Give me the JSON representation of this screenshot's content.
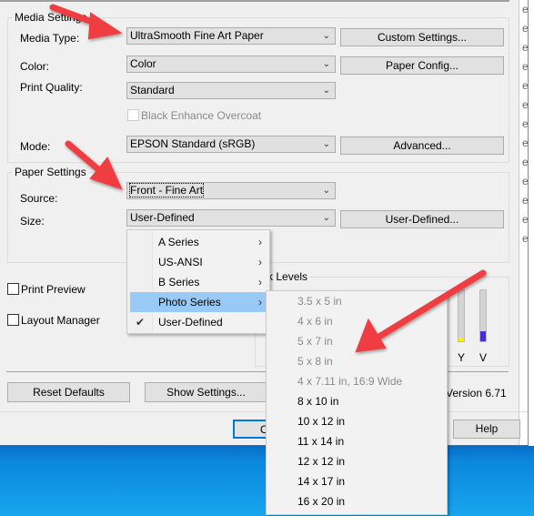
{
  "media_settings": {
    "title": "Media Settings",
    "media_type": {
      "label": "Media Type:",
      "value": "UltraSmooth Fine Art Paper",
      "button": "Custom Settings..."
    },
    "color": {
      "label": "Color:",
      "value": "Color",
      "button": "Paper Config..."
    },
    "print_quality": {
      "label": "Print Quality:",
      "value": "Standard"
    },
    "black_enhance": {
      "label": "Black Enhance Overcoat",
      "checked": false,
      "disabled": true
    },
    "mode": {
      "label": "Mode:",
      "value": "EPSON Standard (sRGB)",
      "button": "Advanced..."
    }
  },
  "paper_settings": {
    "title": "Paper Settings",
    "source": {
      "label": "Source:",
      "value": "Front - Fine Art"
    },
    "size": {
      "label": "Size:",
      "value": "User-Defined",
      "button": "User-Defined..."
    }
  },
  "print_preview": {
    "label": "Print Preview",
    "checked": false
  },
  "layout_manager": {
    "label": "Layout Manager",
    "checked": false
  },
  "ink_levels": {
    "title": "Ink Levels",
    "inks": [
      {
        "label": "Y",
        "color": "#ffee00",
        "level": 0.08
      },
      {
        "label": "V",
        "color": "#4b2bd8",
        "level": 0.2
      }
    ]
  },
  "buttons": {
    "reset": "Reset Defaults",
    "show_settings": "Show Settings...",
    "ok": "OK",
    "help": "Help"
  },
  "version": "Version 6.71",
  "size_menu": {
    "items": [
      {
        "label": "A Series",
        "submenu": true
      },
      {
        "label": "US-ANSI",
        "submenu": true
      },
      {
        "label": "B Series",
        "submenu": true
      },
      {
        "label": "Photo Series",
        "submenu": true,
        "highlighted": true
      },
      {
        "label": "User-Defined",
        "checked": true
      }
    ]
  },
  "photo_submenu": {
    "items": [
      {
        "label": "3.5 x 5 in",
        "disabled": true
      },
      {
        "label": "4 x 6 in",
        "disabled": true
      },
      {
        "label": "5 x 7 in",
        "disabled": true
      },
      {
        "label": "5 x 8 in",
        "disabled": true
      },
      {
        "label": "4 x 7.11 in, 16:9 Wide",
        "disabled": true
      },
      {
        "label": "8 x 10 in"
      },
      {
        "label": "10 x 12 in"
      },
      {
        "label": "11 x 14 in"
      },
      {
        "label": "12 x 12 in"
      },
      {
        "label": "14 x 17 in"
      },
      {
        "label": "16 x 20 in"
      }
    ]
  },
  "colors": {
    "highlight": "#99c9f5",
    "arrow": "#ef3e42",
    "desktop": "#0b86dc"
  }
}
